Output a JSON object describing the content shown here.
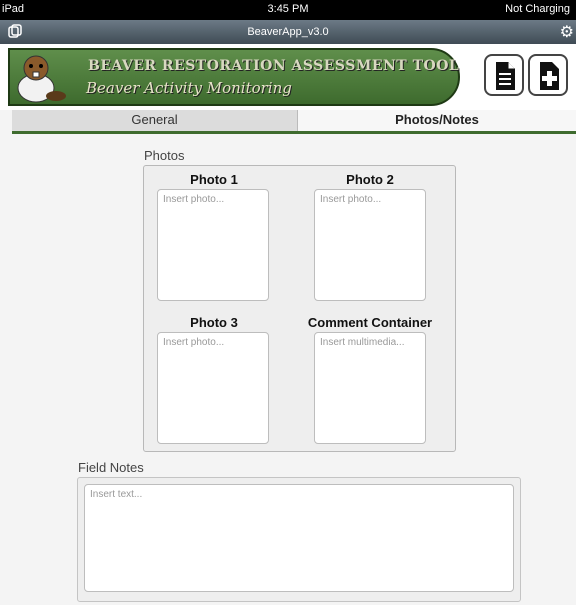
{
  "status_bar": {
    "device": "iPad",
    "time": "3:45 PM",
    "battery": "Not Charging"
  },
  "app": {
    "title": "BeaverApp_v3.0"
  },
  "banner": {
    "title": "BEAVER RESTORATION ASSESSMENT TOOL",
    "subtitle": "Beaver Activity Monitoring"
  },
  "toolbar": {
    "new_document_icon": "document-icon",
    "add_icon": "plus-icon"
  },
  "tabs": [
    {
      "label": "General",
      "active": false
    },
    {
      "label": "Photos/Notes",
      "active": true
    }
  ],
  "photos": {
    "label": "Photos",
    "items": [
      {
        "title": "Photo 1",
        "placeholder": "Insert photo..."
      },
      {
        "title": "Photo 2",
        "placeholder": "Insert photo..."
      },
      {
        "title": "Photo 3",
        "placeholder": "Insert photo..."
      },
      {
        "title": "Comment Container",
        "placeholder": "Insert multimedia..."
      }
    ]
  },
  "field_notes": {
    "label": "Field Notes",
    "placeholder": "Insert text..."
  },
  "colors": {
    "accent_green": "#3e6b2e",
    "titlebar": "#4f5c67"
  }
}
